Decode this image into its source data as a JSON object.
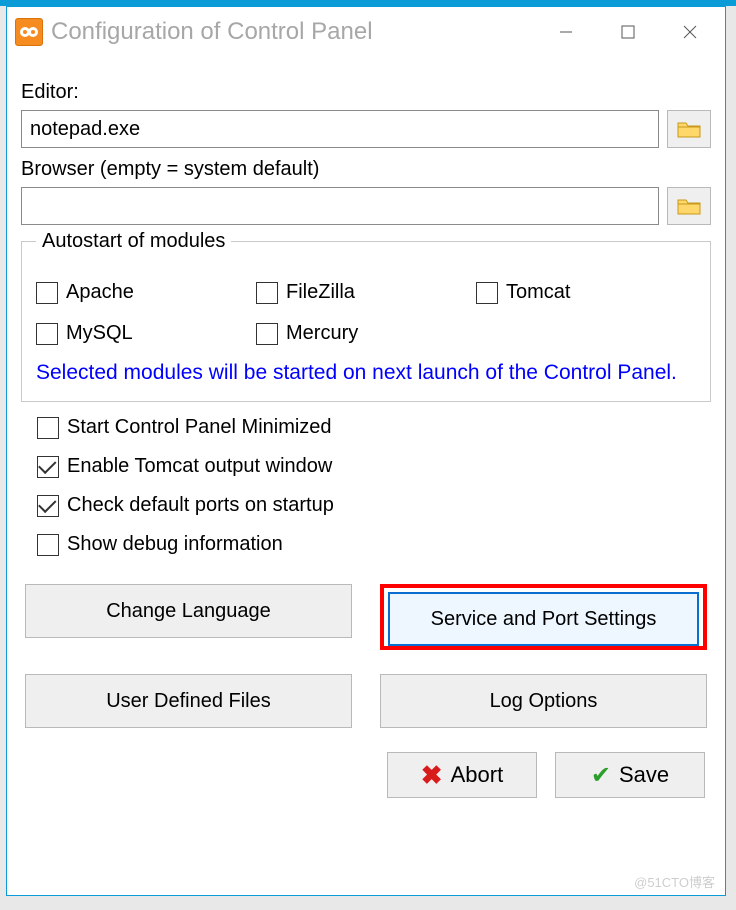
{
  "window": {
    "title": "Configuration of Control Panel"
  },
  "editor": {
    "label": "Editor:",
    "value": "notepad.exe"
  },
  "browser": {
    "label": "Browser (empty = system default)",
    "value": ""
  },
  "autostart": {
    "legend": "Autostart of modules",
    "modules": {
      "apache": "Apache",
      "filezilla": "FileZilla",
      "tomcat": "Tomcat",
      "mysql": "MySQL",
      "mercury": "Mercury"
    },
    "note": "Selected modules will be started on next launch of the Control Panel."
  },
  "options": {
    "start_minimized": "Start Control Panel Minimized",
    "enable_tomcat_output": "Enable Tomcat output window",
    "check_default_ports": "Check default ports on startup",
    "show_debug": "Show debug information"
  },
  "buttons": {
    "change_language": "Change Language",
    "service_ports": "Service and Port Settings",
    "user_defined": "User Defined Files",
    "log_options": "Log Options",
    "abort": "Abort",
    "save": "Save"
  },
  "watermark": "@51CTO博客"
}
